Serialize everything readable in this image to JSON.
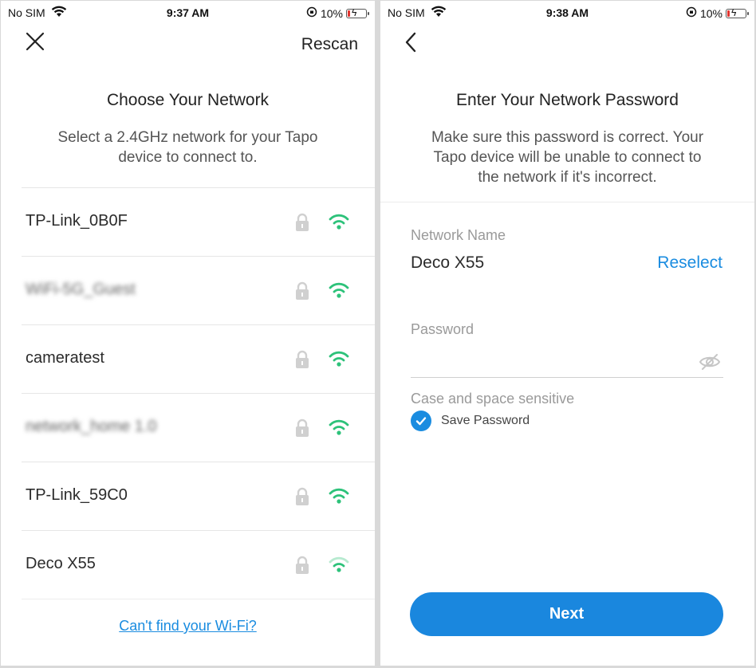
{
  "left_screen": {
    "status": {
      "carrier": "No SIM",
      "time": "9:37 AM",
      "battery": "10%"
    },
    "rescan_label": "Rescan",
    "title": "Choose Your Network",
    "subtitle_line1": "Select a 2.4GHz network for your Tapo",
    "subtitle_line2": "device to connect to.",
    "networks": [
      {
        "name": "TP-Link_0B0F",
        "blurred": false
      },
      {
        "name": "WiFi-5G_Guest",
        "blurred": true
      },
      {
        "name": "cameratest",
        "blurred": false
      },
      {
        "name": "network_home 1.0",
        "blurred": true
      },
      {
        "name": "TP-Link_59C0",
        "blurred": false
      },
      {
        "name": "Deco X55",
        "blurred": false
      }
    ],
    "cant_find": "Can't find your Wi-Fi?"
  },
  "right_screen": {
    "status": {
      "carrier": "No SIM",
      "time": "9:38 AM",
      "battery": "10%"
    },
    "title": "Enter Your Network Password",
    "subtitle_line1": "Make sure this password is correct. Your",
    "subtitle_line2": "Tapo device will be unable to connect to",
    "subtitle_line3": "the network if it's incorrect.",
    "network_name_label": "Network Name",
    "network_name_value": "Deco X55",
    "reselect_label": "Reselect",
    "password_label": "Password",
    "password_value": "",
    "hint": "Case and space sensitive",
    "save_password_label": "Save Password",
    "save_password_checked": true,
    "next_label": "Next"
  },
  "colors": {
    "accent": "#1a8ce0",
    "wifi_green": "#2dc27a",
    "lock_grey": "#d0d0d0"
  }
}
